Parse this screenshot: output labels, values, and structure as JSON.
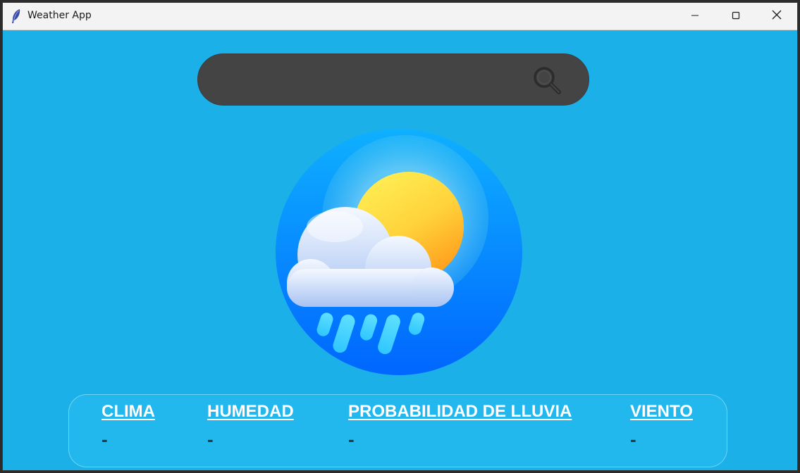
{
  "window": {
    "title": "Weather App",
    "icon": "feather-icon",
    "controls": [
      "minimize-icon",
      "maximize-icon",
      "close-icon"
    ]
  },
  "search": {
    "value": "",
    "placeholder": "",
    "icon": "search-icon"
  },
  "logo": {
    "icon": "weather-sun-cloud-rain-icon"
  },
  "info": {
    "items": [
      {
        "label": "CLIMA",
        "value": "-"
      },
      {
        "label": "HUMEDAD",
        "value": "-"
      },
      {
        "label": "PROBABILIDAD DE LLUVIA",
        "value": "-"
      },
      {
        "label": "VIENTO",
        "value": "-"
      }
    ]
  },
  "colors": {
    "background": "#1cb0e8",
    "search_bar": "#444444",
    "panel": "#22b8ee",
    "label": "#ffffff",
    "value": "#333333"
  }
}
